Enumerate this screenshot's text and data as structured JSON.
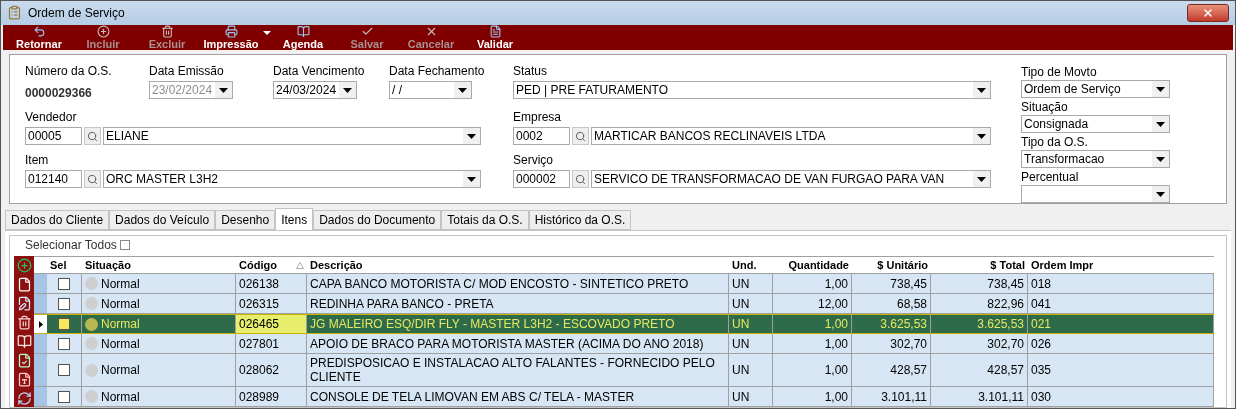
{
  "window": {
    "title": "Ordem de Serviço"
  },
  "toolbar": [
    {
      "label": "Retornar",
      "kind": "back",
      "disabled": false,
      "has_menu": false
    },
    {
      "label": "Incluir",
      "kind": "add",
      "disabled": true,
      "has_menu": false
    },
    {
      "label": "Excluir",
      "kind": "delete",
      "disabled": true,
      "has_menu": false
    },
    {
      "label": "Impressão",
      "kind": "print",
      "disabled": false,
      "has_menu": true
    },
    {
      "label": "Agenda",
      "kind": "book",
      "disabled": false,
      "has_menu": false
    },
    {
      "label": "Salvar",
      "kind": "check",
      "disabled": true,
      "has_menu": false
    },
    {
      "label": "Cancelar",
      "kind": "cancel",
      "disabled": true,
      "has_menu": false
    },
    {
      "label": "Validar",
      "kind": "doc",
      "disabled": false,
      "has_menu": false
    }
  ],
  "form": {
    "numero": {
      "label": "Número da O.S.",
      "value": "0000029366"
    },
    "dates": [
      {
        "label": "Data Emissão",
        "value": "23/02/2024",
        "disabled": true
      },
      {
        "label": "Data Vencimento",
        "value": "24/03/2024",
        "disabled": false
      },
      {
        "label": "Data Fechamento",
        "value": " /  /",
        "disabled": false
      }
    ],
    "status": {
      "label": "Status",
      "value": "PED | PRE FATURAMENTO"
    },
    "lookups_left": [
      {
        "label": "Vendedor",
        "code": "00005",
        "value": "ELIANE"
      },
      {
        "label": "Item",
        "code": "012140",
        "value": "ORC MASTER L3H2"
      }
    ],
    "lookups_right": [
      {
        "label": "Empresa",
        "code": "0002",
        "value": "MARTICAR BANCOS RECLINAVEIS LTDA"
      },
      {
        "label": "Serviço",
        "code": "000002",
        "value": "SERVICO DE TRANSFORMACAO DE VAN FURGAO PARA VAN"
      }
    ],
    "side": [
      {
        "label": "Tipo de Movto",
        "value": "Ordem de Serviço"
      },
      {
        "label": "Situação",
        "value": "Consignada"
      },
      {
        "label": "Tipo da O.S.",
        "value": "Transformacao"
      },
      {
        "label": "Percentual"
      }
    ]
  },
  "tabs": [
    {
      "label": "Dados do Cliente",
      "selected": false
    },
    {
      "label": "Dados do Veículo",
      "selected": false
    },
    {
      "label": "Desenho",
      "selected": false
    },
    {
      "label": "Itens",
      "selected": true
    },
    {
      "label": "Dados do Documento",
      "selected": false
    },
    {
      "label": "Totais da O.S.",
      "selected": false
    },
    {
      "label": "Histórico da O.S.",
      "selected": false
    }
  ],
  "select_all": {
    "label": "Selecionar Todos",
    "checked": false
  },
  "grid_tools": [
    {
      "kind": "add"
    },
    {
      "kind": "file"
    },
    {
      "kind": "edit"
    },
    {
      "kind": "delete"
    },
    {
      "kind": "book"
    },
    {
      "kind": "check"
    },
    {
      "kind": "pdf"
    },
    {
      "kind": "refresh"
    }
  ],
  "table": {
    "columns": [
      {
        "label": "Sel",
        "sorted": false
      },
      {
        "label": "Situação",
        "sorted": false
      },
      {
        "label": "Código",
        "sorted": true
      },
      {
        "label": "Descrição",
        "sorted": false
      },
      {
        "label": "Und.",
        "sorted": false
      },
      {
        "label": "Quantidade",
        "sorted": false
      },
      {
        "label": "$ Unitário",
        "sorted": false
      },
      {
        "label": "$ Total",
        "sorted": false
      },
      {
        "label": "Ordem Impr",
        "sorted": false
      }
    ],
    "rows": [
      {
        "selected": false,
        "checked": false,
        "cells": [
          "",
          "Normal",
          "026138",
          "CAPA BANCO MOTORISTA C/ MOD ENCOSTO - SINTETICO PRETO",
          "UN",
          "1,00",
          "738,45",
          "738,45",
          "018"
        ]
      },
      {
        "selected": false,
        "checked": false,
        "cells": [
          "",
          "Normal",
          "026315",
          "REDINHA PARA BANCO - PRETA",
          "UN",
          "12,00",
          "68,58",
          "822,96",
          "041"
        ]
      },
      {
        "selected": true,
        "checked": false,
        "cells": [
          "",
          "Normal",
          "026465",
          "JG MALEIRO ESQ/DIR FLY - MASTER L3H2 - ESCOVADO PRETO",
          "UN",
          "1,00",
          "3.625,53",
          "3.625,53",
          "021"
        ]
      },
      {
        "selected": false,
        "checked": false,
        "cells": [
          "",
          "Normal",
          "027801",
          "APOIO DE BRACO PARA MOTORISTA MASTER (ACIMA DO ANO 2018)",
          "UN",
          "1,00",
          "302,70",
          "302,70",
          "026"
        ]
      },
      {
        "selected": false,
        "checked": false,
        "cells": [
          "",
          "Normal",
          "028062",
          "PREDISPOSICAO E INSTALACAO ALTO FALANTES - FORNECIDO PELO CLIENTE",
          "UN",
          "1,00",
          "428,57",
          "428,57",
          "035"
        ]
      },
      {
        "selected": false,
        "checked": false,
        "cells": [
          "",
          "Normal",
          "028989",
          "CONSOLE DE TELA LIMOVAN EM ABS C/ TELA - MASTER",
          "UN",
          "1,00",
          "3.101,11",
          "3.101,11",
          "030"
        ]
      }
    ]
  }
}
